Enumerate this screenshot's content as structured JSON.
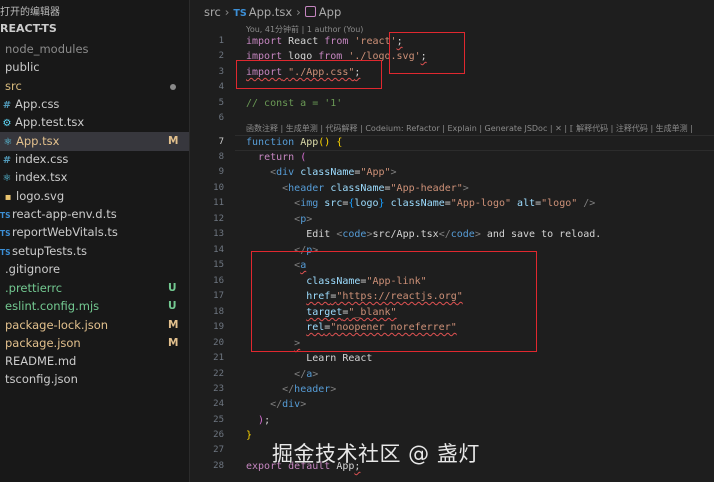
{
  "explorer": {
    "title": "打开的编辑器",
    "project": "REACT-TS",
    "items": [
      {
        "name": "node_modules",
        "icon": "",
        "kind": "folder",
        "status": "",
        "style": "dim"
      },
      {
        "name": "public",
        "icon": "",
        "kind": "folder",
        "status": "",
        "style": ""
      },
      {
        "name": "src",
        "icon": "",
        "kind": "folder",
        "status": "",
        "style": "gold"
      },
      {
        "name": "App.css",
        "icon": "#",
        "kind": "css",
        "status": "",
        "style": ""
      },
      {
        "name": "App.test.tsx",
        "icon": "⚙",
        "kind": "tsx",
        "status": "",
        "style": ""
      },
      {
        "name": "App.tsx",
        "icon": "⚛",
        "kind": "tsx",
        "status": "M",
        "style": "modified"
      },
      {
        "name": "index.css",
        "icon": "#",
        "kind": "css",
        "status": "",
        "style": ""
      },
      {
        "name": "index.tsx",
        "icon": "⚛",
        "kind": "tsx",
        "status": "",
        "style": ""
      },
      {
        "name": "logo.svg",
        "icon": "▪",
        "kind": "svg",
        "status": "",
        "style": ""
      },
      {
        "name": "react-app-env.d.ts",
        "icon": "TS",
        "kind": "ts",
        "status": "",
        "style": ""
      },
      {
        "name": "reportWebVitals.ts",
        "icon": "TS",
        "kind": "ts",
        "status": "",
        "style": ""
      },
      {
        "name": "setupTests.ts",
        "icon": "TS",
        "kind": "ts",
        "status": "",
        "style": ""
      },
      {
        "name": ".gitignore",
        "icon": "",
        "kind": "file",
        "status": "",
        "style": ""
      },
      {
        "name": ".prettierrc",
        "icon": "",
        "kind": "file",
        "status": "U",
        "style": "green"
      },
      {
        "name": "eslint.config.mjs",
        "icon": "",
        "kind": "file",
        "status": "U",
        "style": "green"
      },
      {
        "name": "package-lock.json",
        "icon": "",
        "kind": "file",
        "status": "M",
        "style": "modified"
      },
      {
        "name": "package.json",
        "icon": "",
        "kind": "file",
        "status": "M",
        "style": "modified"
      },
      {
        "name": "README.md",
        "icon": "",
        "kind": "file",
        "status": "",
        "style": ""
      },
      {
        "name": "tsconfig.json",
        "icon": "",
        "kind": "file",
        "status": "",
        "style": ""
      }
    ]
  },
  "breadcrumb": {
    "folder": "src",
    "file": "App.tsx",
    "file_icon": "TS",
    "symbol": "App"
  },
  "blame_lens": "You, 41分钟前 | 1 author (You)",
  "codelens": "函数注释 | 生成单测 | 代码解释 | Codeium: Refactor | Explain | Generate JSDoc | ✕ | ⟦ 解释代码 | 注释代码 | 生成单测 |",
  "current_line": "7",
  "lines": [
    {
      "n": "1",
      "segs": [
        [
          "import",
          "kw2"
        ],
        [
          " React ",
          ""
        ],
        [
          "from",
          "kw2"
        ],
        [
          " ",
          ""
        ],
        [
          "'react'",
          "str"
        ],
        [
          ";",
          "sq"
        ]
      ]
    },
    {
      "n": "2",
      "segs": [
        [
          "import",
          "kw2"
        ],
        [
          " logo ",
          ""
        ],
        [
          "from",
          "kw2"
        ],
        [
          " ",
          ""
        ],
        [
          "'./logo.svg'",
          "str"
        ],
        [
          ";",
          "sq"
        ]
      ]
    },
    {
      "n": "3",
      "segs": [
        [
          "import",
          "kw2 sq"
        ],
        [
          " ",
          "sq"
        ],
        [
          "\"./App.css\"",
          "str sq"
        ],
        [
          ";",
          "sq"
        ]
      ]
    },
    {
      "n": "4",
      "segs": []
    },
    {
      "n": "5",
      "segs": [
        [
          "// const a = '1'",
          "cm"
        ]
      ]
    },
    {
      "n": "6",
      "segs": []
    },
    {
      "n": "7",
      "segs": [
        [
          "function",
          "kw"
        ],
        [
          " ",
          ""
        ],
        [
          "App",
          "fn"
        ],
        [
          "(",
          "br1"
        ],
        [
          ")",
          "br1"
        ],
        [
          " ",
          ""
        ],
        [
          "{",
          "br1"
        ]
      ]
    },
    {
      "n": "8",
      "segs": [
        [
          "  ",
          ""
        ],
        [
          "return",
          "kw2"
        ],
        [
          " ",
          ""
        ],
        [
          "(",
          "br2"
        ]
      ]
    },
    {
      "n": "9",
      "segs": [
        [
          "    ",
          ""
        ],
        [
          "<",
          "gr"
        ],
        [
          "div",
          "tag"
        ],
        [
          " ",
          ""
        ],
        [
          "className",
          "attr"
        ],
        [
          "=",
          ""
        ],
        [
          "\"App\"",
          "str"
        ],
        [
          ">",
          "gr"
        ]
      ]
    },
    {
      "n": "10",
      "segs": [
        [
          "      ",
          ""
        ],
        [
          "<",
          "gr"
        ],
        [
          "header",
          "tag"
        ],
        [
          " ",
          ""
        ],
        [
          "className",
          "attr"
        ],
        [
          "=",
          ""
        ],
        [
          "\"App-header\"",
          "str"
        ],
        [
          ">",
          "gr"
        ]
      ]
    },
    {
      "n": "11",
      "segs": [
        [
          "        ",
          ""
        ],
        [
          "<",
          "gr"
        ],
        [
          "img",
          "tag"
        ],
        [
          " ",
          ""
        ],
        [
          "src",
          "attr"
        ],
        [
          "=",
          ""
        ],
        [
          "{",
          "br3"
        ],
        [
          "logo",
          "var"
        ],
        [
          "}",
          "br3"
        ],
        [
          " ",
          ""
        ],
        [
          "className",
          "attr"
        ],
        [
          "=",
          ""
        ],
        [
          "\"App-logo\"",
          "str"
        ],
        [
          " ",
          ""
        ],
        [
          "alt",
          "attr"
        ],
        [
          "=",
          ""
        ],
        [
          "\"logo\"",
          "str"
        ],
        [
          " />",
          "gr"
        ]
      ]
    },
    {
      "n": "12",
      "segs": [
        [
          "        ",
          ""
        ],
        [
          "<",
          "gr"
        ],
        [
          "p",
          "tag"
        ],
        [
          ">",
          "gr"
        ]
      ]
    },
    {
      "n": "13",
      "segs": [
        [
          "          Edit ",
          ""
        ],
        [
          "<",
          "gr"
        ],
        [
          "code",
          "tag"
        ],
        [
          ">",
          "gr"
        ],
        [
          "src/App.tsx",
          ""
        ],
        [
          "</",
          "gr"
        ],
        [
          "code",
          "tag"
        ],
        [
          ">",
          "gr"
        ],
        [
          " and save to reload.",
          ""
        ]
      ]
    },
    {
      "n": "14",
      "segs": [
        [
          "        ",
          ""
        ],
        [
          "</",
          "gr"
        ],
        [
          "p",
          "tag"
        ],
        [
          ">",
          "gr"
        ]
      ]
    },
    {
      "n": "15",
      "segs": [
        [
          "        ",
          ""
        ],
        [
          "<",
          "gr"
        ],
        [
          "a",
          "tag sq"
        ]
      ]
    },
    {
      "n": "16",
      "segs": [
        [
          "          ",
          ""
        ],
        [
          "className",
          "attr"
        ],
        [
          "=",
          ""
        ],
        [
          "\"App-link\"",
          "str"
        ]
      ]
    },
    {
      "n": "17",
      "segs": [
        [
          "          ",
          ""
        ],
        [
          "href",
          "attr sq"
        ],
        [
          "=",
          "sq"
        ],
        [
          "\"https://reactjs.org\"",
          "str sq"
        ]
      ]
    },
    {
      "n": "18",
      "segs": [
        [
          "          ",
          ""
        ],
        [
          "target",
          "attr sq"
        ],
        [
          "=",
          "sq"
        ],
        [
          "\"_blank\"",
          "str sq"
        ]
      ]
    },
    {
      "n": "19",
      "segs": [
        [
          "          ",
          ""
        ],
        [
          "rel",
          "attr sq"
        ],
        [
          "=",
          "sq"
        ],
        [
          "\"noopener noreferrer\"",
          "str sq"
        ]
      ]
    },
    {
      "n": "20",
      "segs": [
        [
          "        ",
          ""
        ],
        [
          ">",
          "gr sq"
        ]
      ]
    },
    {
      "n": "21",
      "segs": [
        [
          "          Learn React",
          ""
        ]
      ]
    },
    {
      "n": "22",
      "segs": [
        [
          "        ",
          ""
        ],
        [
          "</",
          "gr"
        ],
        [
          "a",
          "tag"
        ],
        [
          ">",
          "gr"
        ]
      ]
    },
    {
      "n": "23",
      "segs": [
        [
          "      ",
          ""
        ],
        [
          "</",
          "gr"
        ],
        [
          "header",
          "tag"
        ],
        [
          ">",
          "gr"
        ]
      ]
    },
    {
      "n": "24",
      "segs": [
        [
          "    ",
          ""
        ],
        [
          "</",
          "gr"
        ],
        [
          "div",
          "tag"
        ],
        [
          ">",
          "gr"
        ]
      ]
    },
    {
      "n": "25",
      "segs": [
        [
          "  ",
          ""
        ],
        [
          ")",
          "br2"
        ],
        [
          ";",
          ""
        ]
      ]
    },
    {
      "n": "26",
      "segs": [
        [
          "}",
          "br1"
        ]
      ]
    },
    {
      "n": "27",
      "segs": []
    },
    {
      "n": "28",
      "segs": [
        [
          "export",
          "kw2"
        ],
        [
          " ",
          ""
        ],
        [
          "default",
          "kw2"
        ],
        [
          " App",
          ""
        ],
        [
          ";",
          "sq"
        ]
      ]
    }
  ],
  "watermark": "掘金技术社区 @ 盏灯",
  "colors": {
    "annotation_box": "#e0282f",
    "modified": "#e2c08d",
    "untracked": "#73c991",
    "squiggle": "#e05252"
  }
}
